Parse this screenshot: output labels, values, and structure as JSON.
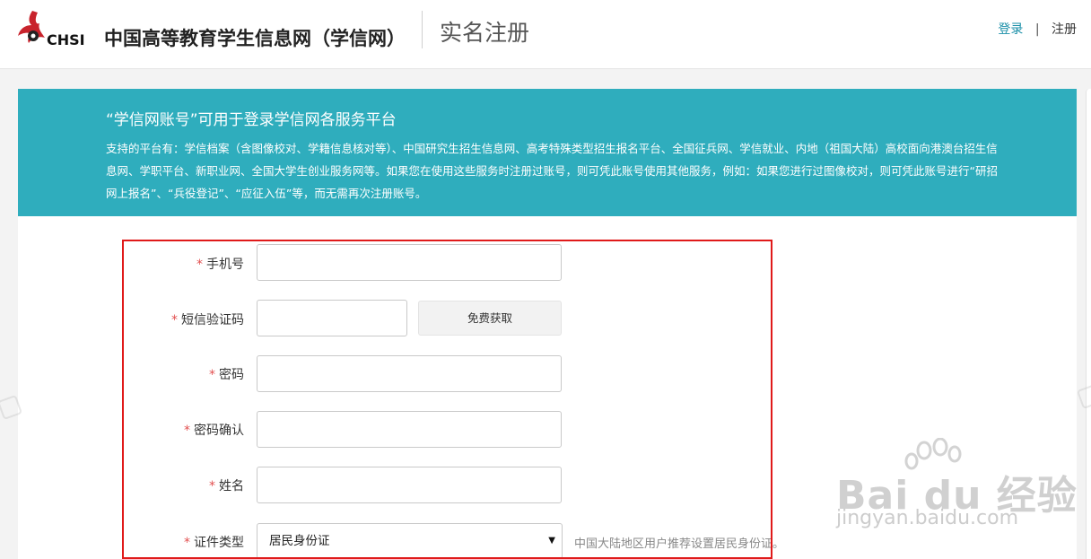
{
  "header": {
    "logo_text": "CHSI",
    "site_name": "中国高等教育学生信息网（学信网）",
    "page_title": "实名注册",
    "login_link": "登录",
    "separator": "|",
    "register_link": "注册"
  },
  "banner": {
    "title": "“学信网账号”可用于登录学信网各服务平台",
    "description": "支持的平台有：学信档案（含图像校对、学籍信息核对等）、中国研究生招生信息网、高考特殊类型招生报名平台、全国征兵网、学信就业、内地（祖国大陆）高校面向港澳台招生信息网、学职平台、新职业网、全国大学生创业服务网等。如果您在使用这些服务时注册过账号，则可凭此账号使用其他服务，例如：如果您进行过图像校对，则可凭此账号进行“研招网上报名”、“兵役登记”、“应征入伍”等，而无需再次注册账号。",
    "colors": {
      "background": "#2fadbd",
      "text": "#ffffff"
    }
  },
  "form": {
    "required_mark": "*",
    "phone": {
      "label": "手机号",
      "value": "",
      "placeholder": ""
    },
    "sms_code": {
      "label": "短信验证码",
      "value": "",
      "placeholder": "",
      "button_label": "免费获取"
    },
    "password": {
      "label": "密码",
      "value": "",
      "placeholder": ""
    },
    "password_confirm": {
      "label": "密码确认",
      "value": "",
      "placeholder": ""
    },
    "name": {
      "label": "姓名",
      "value": "",
      "placeholder": ""
    },
    "id_type": {
      "label": "证件类型",
      "selected": "居民身份证",
      "hint": "中国大陆地区用户推荐设置居民身份证。"
    }
  },
  "watermark": {
    "brand": "Bai du 经验",
    "url": "jingyan.baidu.com"
  },
  "colors": {
    "accent_link": "#1a8fa8",
    "required": "#e25050",
    "highlight_border": "#e01a1a",
    "page_background": "#f3f3f3"
  },
  "icons": {
    "logo": "chsi-bird-logo-icon",
    "select_arrow": "triangle-down-icon"
  }
}
